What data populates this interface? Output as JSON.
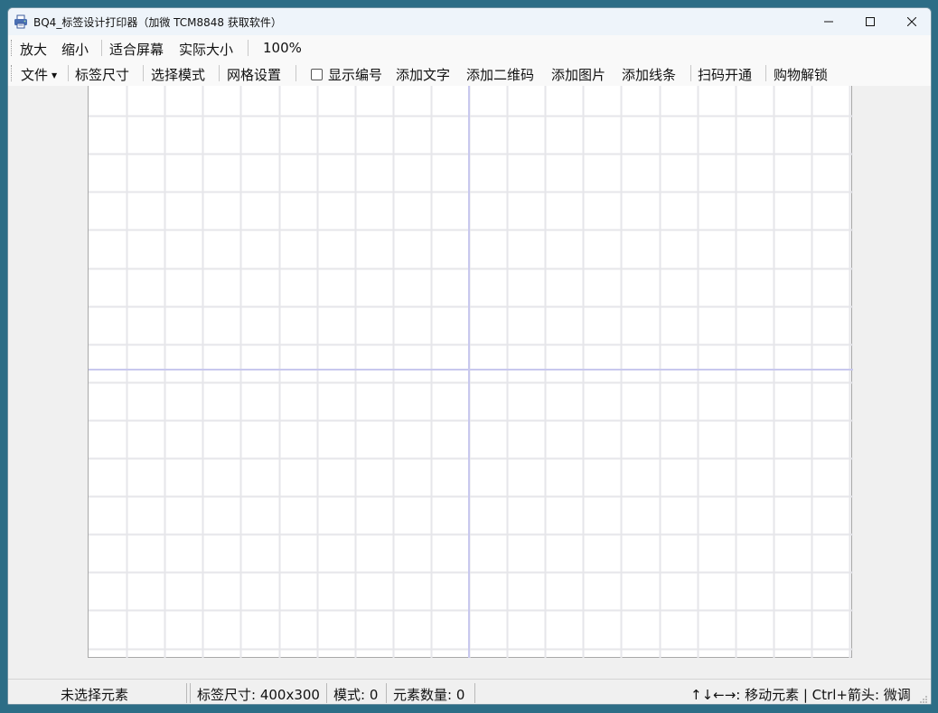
{
  "window": {
    "title": "BQ4_标签设计打印器（加微 TCM8848 获取软件）",
    "controls": {
      "minimize": "—",
      "maximize": "☐",
      "close": "✕"
    }
  },
  "toolbar_view": {
    "zoom_in": "放大",
    "zoom_out": "缩小",
    "fit_screen": "适合屏幕",
    "actual_size": "实际大小",
    "zoom_level": "100%"
  },
  "toolbar_main": {
    "file_menu": "文件",
    "label_size": "标签尺寸",
    "select_mode": "选择模式",
    "grid_settings": "网格设置",
    "show_numbers": {
      "label": "显示编号",
      "checked": false
    },
    "add_text": "添加文字",
    "add_qrcode": "添加二维码",
    "add_image": "添加图片",
    "add_line": "添加线条",
    "scan_activate": "扫码开通",
    "purchase_unlock": "购物解锁"
  },
  "canvas": {
    "grid_color": "#e6e6ea",
    "center_line_color": "#c8c8ee",
    "background": "#ffffff"
  },
  "statusbar": {
    "selection": "未选择元素",
    "label_size": "标签尺寸: 400x300",
    "mode": "模式: 0",
    "element_count": "元素数量: 0",
    "hint": "↑↓←→: 移动元素 | Ctrl+箭头: 微调"
  }
}
